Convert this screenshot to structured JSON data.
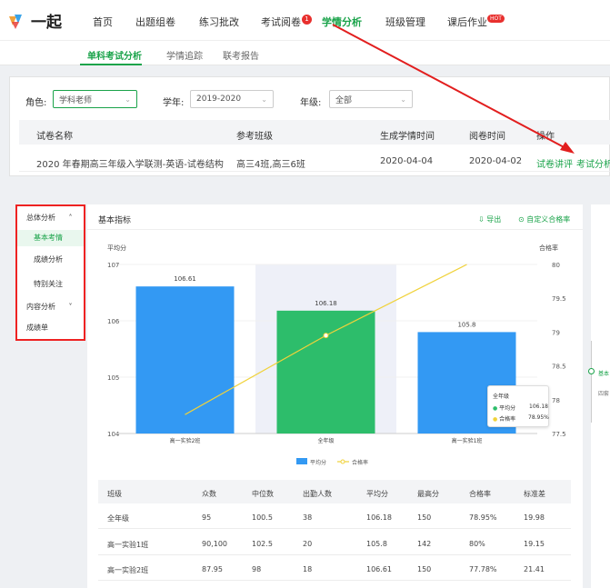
{
  "header": {
    "logo_text": "一起",
    "nav": [
      "首页",
      "出题组卷",
      "练习批改",
      "考试阅卷",
      "学情分析",
      "班级管理",
      "课后作业"
    ],
    "badge_count": "1",
    "hot_label": "HOT"
  },
  "subnav": [
    "单科考试分析",
    "学情追踪",
    "联考报告"
  ],
  "filters": {
    "role_label": "角色:",
    "role_value": "学科老师",
    "year_label": "学年:",
    "year_value": "2019-2020",
    "grade_label": "年级:",
    "grade_value": "全部"
  },
  "exam_table": {
    "headers": [
      "试卷名称",
      "参考班级",
      "生成学情时间",
      "阅卷时间",
      "操作"
    ],
    "row": {
      "name": "2020 年春期高三年级入学联测-英语-试卷结构",
      "classes": "高三4班,高三6班",
      "gen_time": "2020-04-04",
      "mark_time": "2020-04-02",
      "action1": "试卷讲评",
      "action2": "考试分析"
    }
  },
  "sidebar": {
    "group1": "总体分析",
    "items": [
      "基本考情",
      "成绩分析",
      "特别关注"
    ],
    "group2": "内容分析",
    "report": "成绩单"
  },
  "main": {
    "title": "基本指标",
    "export": "导出",
    "custom": "自定义合格率"
  },
  "right_stub": {
    "label1": "基本",
    "label2": "四套"
  },
  "chart_data": {
    "type": "bar",
    "categories": [
      "高一实验2班",
      "全年级",
      "高一实验1班"
    ],
    "series": [
      {
        "name": "平均分",
        "values": [
          106.61,
          106.18,
          105.8
        ],
        "colors": [
          "#3399f3",
          "#2dbd6b",
          "#3399f3"
        ]
      },
      {
        "name": "合格率",
        "values": [
          77.78,
          78.95,
          80
        ],
        "type": "line",
        "color": "#f0d23a"
      }
    ],
    "ylabel_left": "平均分",
    "ylabel_right": "合格率",
    "ylim_left": [
      104,
      107
    ],
    "yticks_left": [
      "107",
      "106",
      "105",
      "104"
    ],
    "ylim_right": [
      77.5,
      80
    ],
    "yticks_right": [
      "80",
      "79.5",
      "79",
      "78.5",
      "78",
      "77.5"
    ],
    "bar_labels": [
      "106.61",
      "106.18",
      "105.8"
    ],
    "highlighted_category": "全年级",
    "legend": [
      "平均分",
      "合格率"
    ],
    "tooltip": {
      "title": "全年级",
      "rows": [
        [
          "平均分",
          "106.18"
        ],
        [
          "合格率",
          "78.95%"
        ]
      ]
    }
  },
  "stats_table": {
    "headers": [
      "班级",
      "众数",
      "中位数",
      "出勤人数",
      "平均分",
      "最高分",
      "合格率",
      "标准差"
    ],
    "rows": [
      [
        "全年级",
        "95",
        "100.5",
        "38",
        "106.18",
        "150",
        "78.95%",
        "19.98"
      ],
      [
        "高一实验1班",
        "90,100",
        "102.5",
        "20",
        "105.8",
        "142",
        "80%",
        "19.15"
      ],
      [
        "高一实验2班",
        "87.95",
        "98",
        "18",
        "106.61",
        "150",
        "77.78%",
        "21.41"
      ]
    ]
  }
}
